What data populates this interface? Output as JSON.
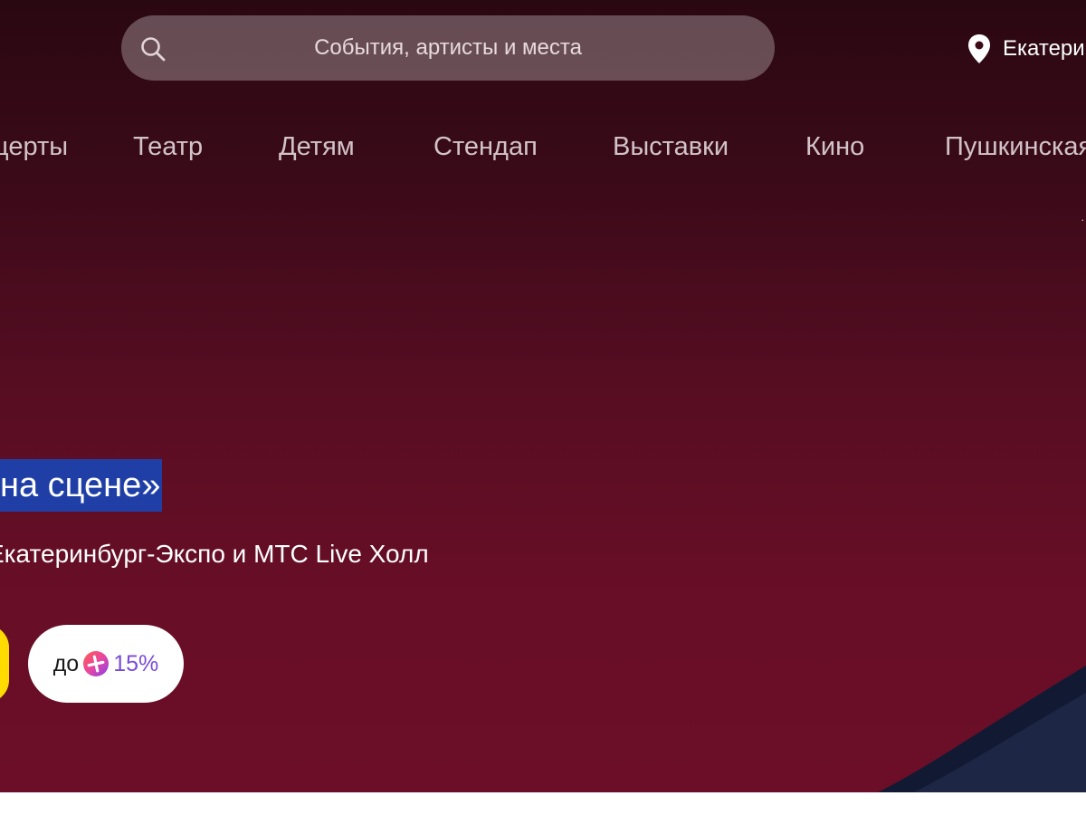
{
  "search": {
    "placeholder": "События, артисты и места",
    "icon": "search-icon"
  },
  "location": {
    "city": "Екатеринбург",
    "icon": "map-pin-icon"
  },
  "nav": {
    "items": [
      {
        "label": "Концерты"
      },
      {
        "label": "Театр"
      },
      {
        "label": "Детям"
      },
      {
        "label": "Стендап"
      },
      {
        "label": "Выставки"
      },
      {
        "label": "Кино"
      },
      {
        "label": "Пушкинская карта"
      }
    ]
  },
  "promo": {
    "headline": "на сцене»",
    "venue": "Екатеринбург-Экспо и МТС Live Холл",
    "cashback": {
      "prefix": "до",
      "icon": "plus-icon",
      "value": "15%"
    }
  },
  "colors": {
    "hero_top": "#2a0811",
    "hero_bottom": "#6c0e28",
    "selection": "#1f3fa6",
    "accent_yellow": "#ffdb00",
    "cashback_purple": "#7a4bd8"
  }
}
